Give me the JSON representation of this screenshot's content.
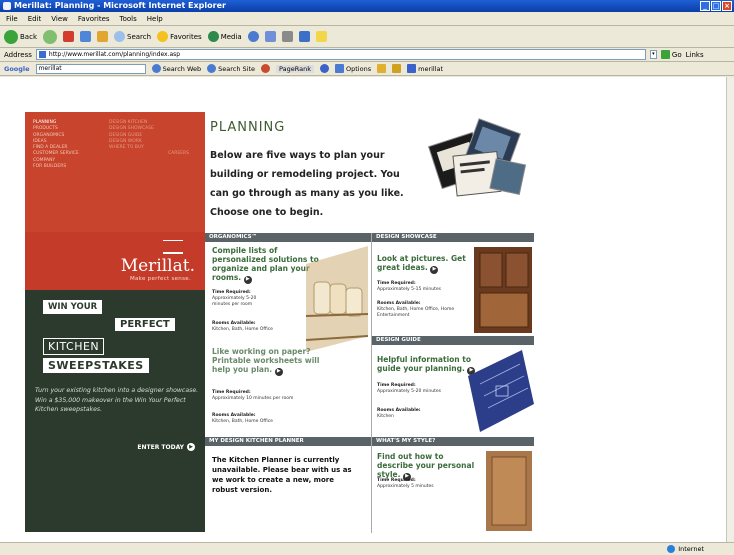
{
  "browser": {
    "title": "Merillat: Planning - Microsoft Internet Explorer",
    "menu": [
      "File",
      "Edit",
      "View",
      "Favorites",
      "Tools",
      "Help"
    ],
    "toolbar": {
      "back": "Back",
      "search": "Search",
      "favorites": "Favorites",
      "media": "Media"
    },
    "address_label": "Address",
    "address_value": "http://www.merillat.com/planning/index.asp",
    "go_label": "Go",
    "links_label": "Links",
    "google": {
      "label": "Google",
      "query": "merillat",
      "search_web": "Search Web",
      "search_site": "Search Site",
      "pagerank": "PageRank",
      "options": "Options",
      "highlight_term": "merillat"
    },
    "status_zone": "Internet"
  },
  "nav": {
    "col1": [
      "Planning",
      "Products",
      "Organomics",
      "Ideas",
      "Find a Dealer",
      "Customer Service",
      "Company",
      "For Builders"
    ],
    "col2": [
      "Design Kitchen",
      "Design Showcase",
      "Design Guide",
      "Design Work",
      "Where to Buy",
      "",
      "",
      "Careers"
    ]
  },
  "brand": {
    "name": "Merillat.",
    "tagline": "Make perfect sense."
  },
  "sweepstakes": {
    "win_your": "WIN YOUR",
    "perfect": "PERFECT",
    "kitchen": "KITCHEN",
    "sweepstakes": "SWEEPSTAKES",
    "body": "Turn your existing kitchen into a designer showcase. Win a $35,000 makeover in the Win Your Perfect Kitchen sweepstakes.",
    "enter": "ENTER TODAY"
  },
  "planning": {
    "title": "PLANNING",
    "intro": "Below are five ways to plan your building or remodeling project. You can go through as many as you like. Choose one to begin."
  },
  "sections": {
    "organomics": {
      "head": "ORGANOMICS™",
      "lead": "Compile lists of personalized solutions to organize and plan your rooms.",
      "time_label": "Time Required:",
      "time_val": "Approximately 5-20 minutes per room",
      "rooms_label": "Rooms Available:",
      "rooms_val": "Kitchen, Bath, Home Office"
    },
    "worksheets": {
      "lead": "Like working on paper? Printable worksheets will help you plan.",
      "time_label": "Time Required:",
      "time_val": "Approximately 10 minutes per room",
      "rooms_label": "Rooms Available:",
      "rooms_val": "Kitchen, Bath, Home Office"
    },
    "showcase": {
      "head": "DESIGN SHOWCASE",
      "lead": "Look at pictures. Get great ideas.",
      "time_label": "Time Required:",
      "time_val": "Approximately 5-15 minutes",
      "rooms_label": "Rooms Available:",
      "rooms_val": "Kitchen, Bath, Home Office, Home Entertainment"
    },
    "guide": {
      "head": "DESIGN GUIDE",
      "lead": "Helpful information to guide your planning.",
      "time_label": "Time Required:",
      "time_val": "Approximately 5-20 minutes",
      "rooms_label": "Rooms Available:",
      "rooms_val": "Kitchen"
    },
    "planner": {
      "head": "MY DESIGN KITCHEN PLANNER",
      "text": "The Kitchen Planner is currently unavailable. Please bear with us as we work to create a new, more robust version."
    },
    "style": {
      "head": "WHAT'S MY STYLE?",
      "lead": "Find out how to describe your personal style.",
      "time_label": "Time Required:",
      "time_val": "Approximately 5 minutes"
    }
  },
  "colors": {
    "nav_red": "#c8442c",
    "sweep_green": "#2c3a2e",
    "section_head": "#5a6468",
    "lead_green": "#3a6b3a"
  }
}
